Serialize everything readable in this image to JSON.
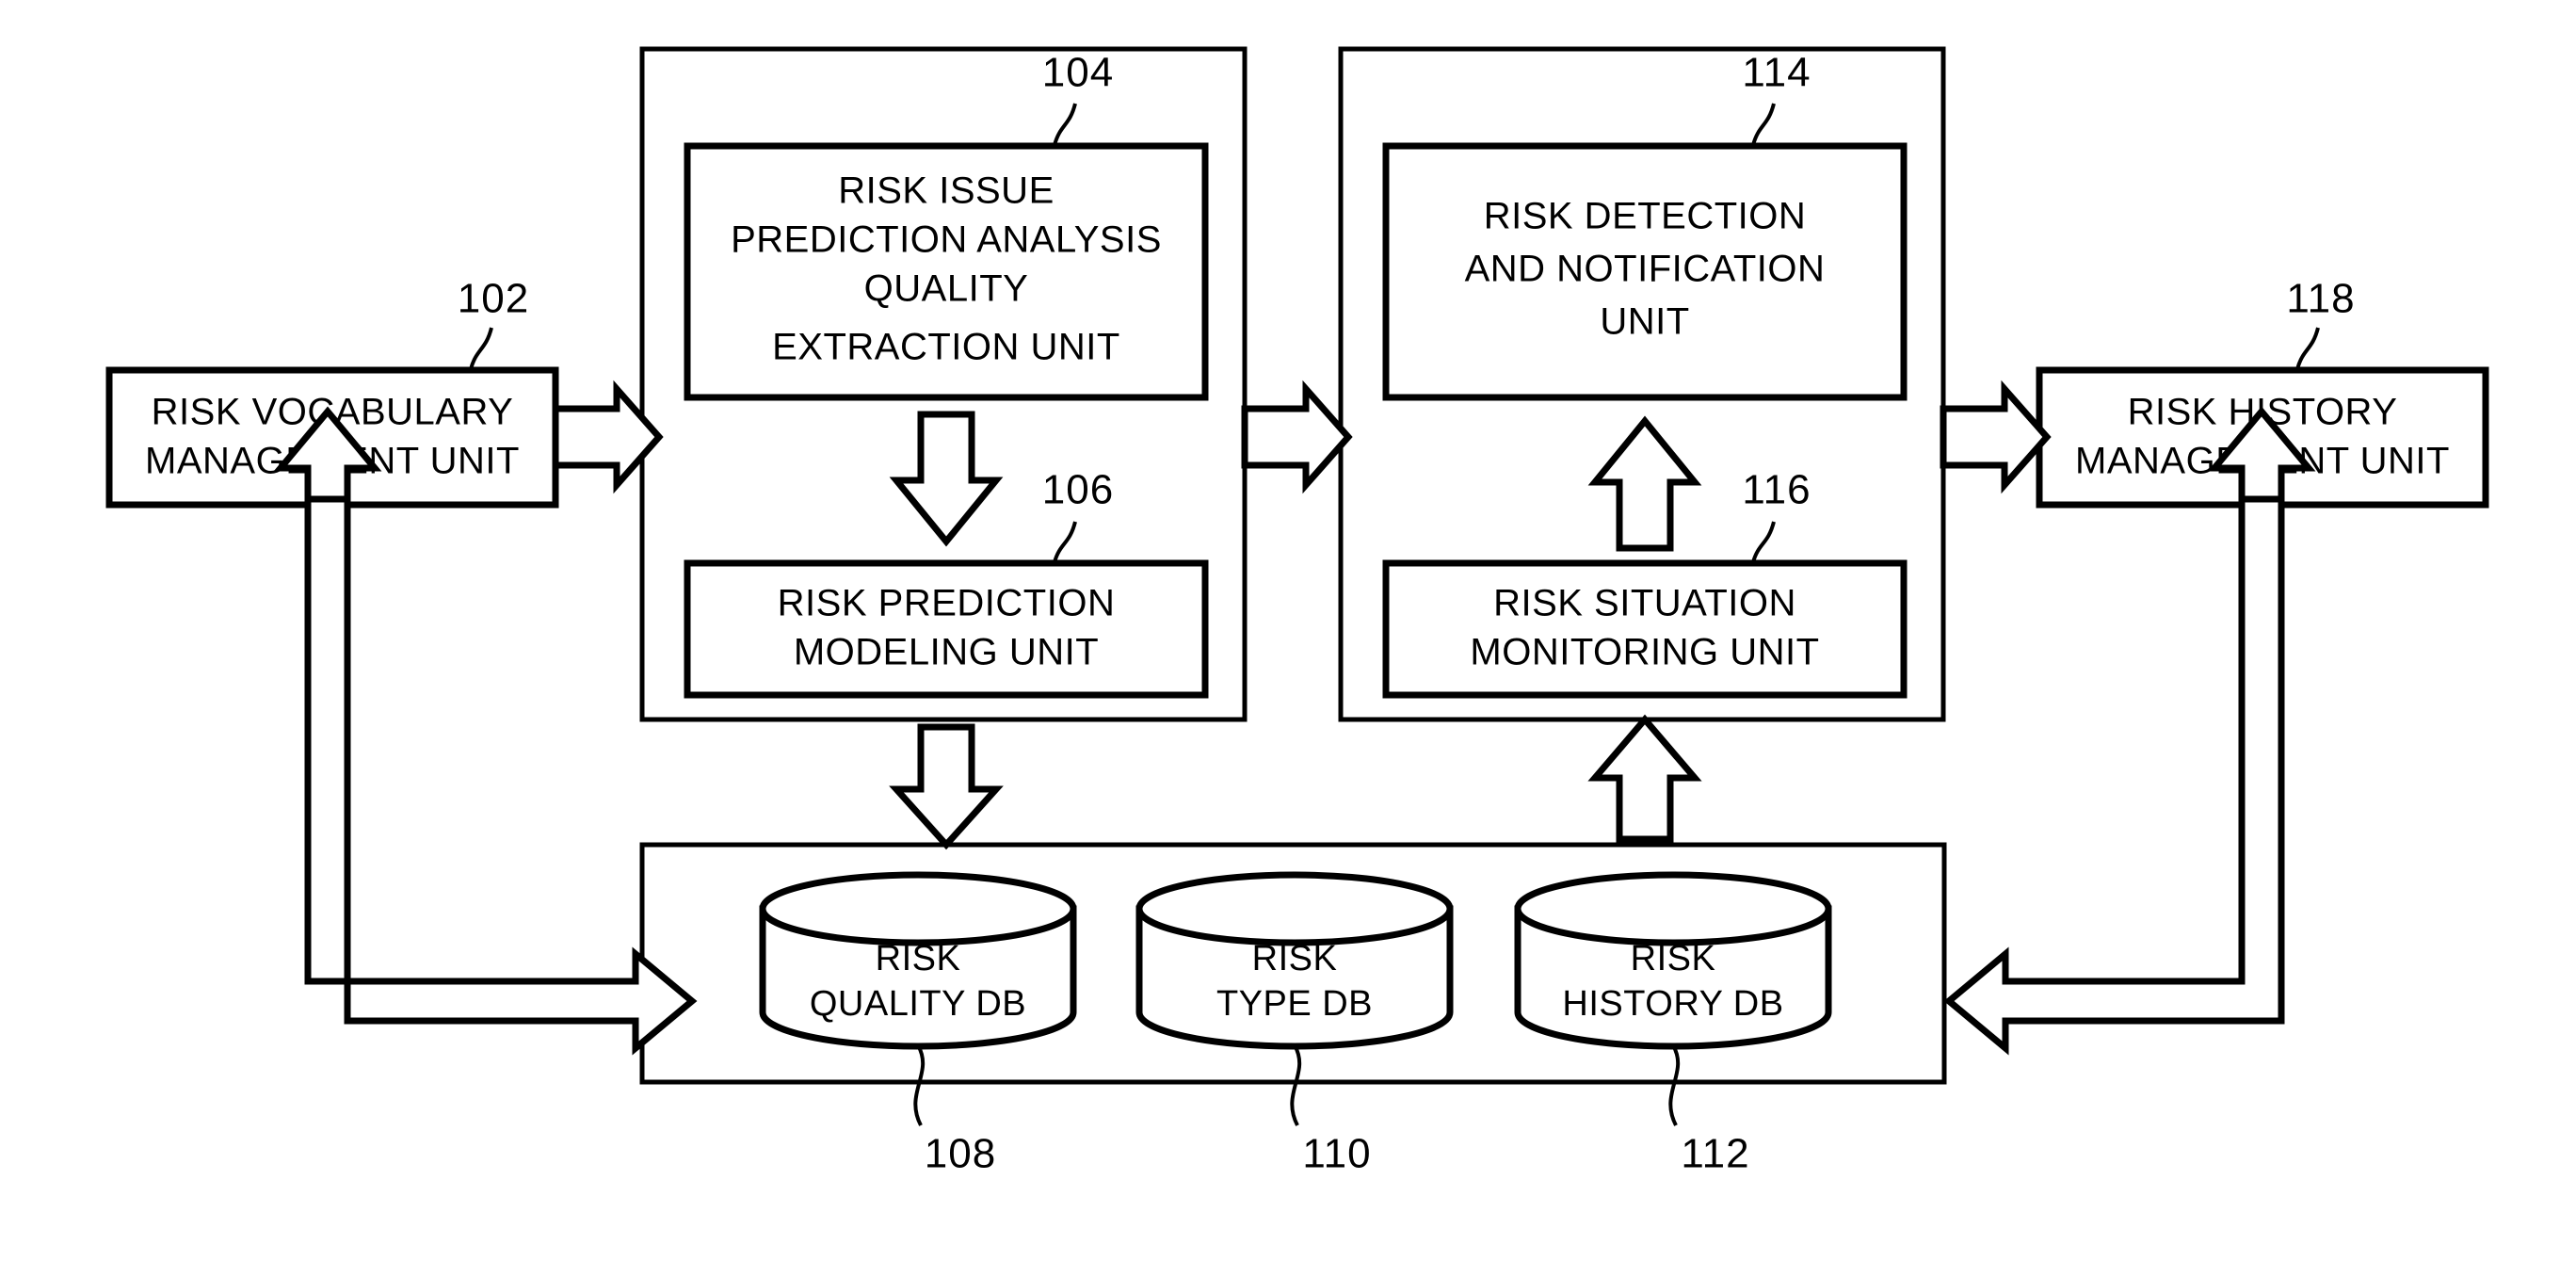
{
  "figure": {
    "type": "patent-block-diagram",
    "background": "#ffffff",
    "line_color": "#000000"
  },
  "blocks": {
    "vocabulary": {
      "ref": "102",
      "lines": [
        "RISK VOCABULARY",
        "MANAGEMENT UNIT"
      ]
    },
    "extraction": {
      "ref": "104",
      "lines": [
        "RISK ISSUE",
        "PREDICTION ANALYSIS",
        "QUALITY",
        "EXTRACTION UNIT"
      ]
    },
    "modeling": {
      "ref": "106",
      "lines": [
        "RISK PREDICTION",
        "MODELING UNIT"
      ]
    },
    "detection": {
      "ref": "114",
      "lines": [
        "RISK DETECTION",
        "AND NOTIFICATION",
        "UNIT"
      ]
    },
    "monitoring": {
      "ref": "116",
      "lines": [
        "RISK SITUATION",
        "MONITORING UNIT"
      ]
    },
    "history": {
      "ref": "118",
      "lines": [
        "RISK HISTORY",
        "MANAGEMENT UNIT"
      ]
    }
  },
  "databases": [
    {
      "ref": "108",
      "lines": [
        "RISK",
        "QUALITY DB"
      ]
    },
    {
      "ref": "110",
      "lines": [
        "RISK",
        "TYPE DB"
      ]
    },
    {
      "ref": "112",
      "lines": [
        "RISK",
        "HISTORY DB"
      ]
    }
  ]
}
